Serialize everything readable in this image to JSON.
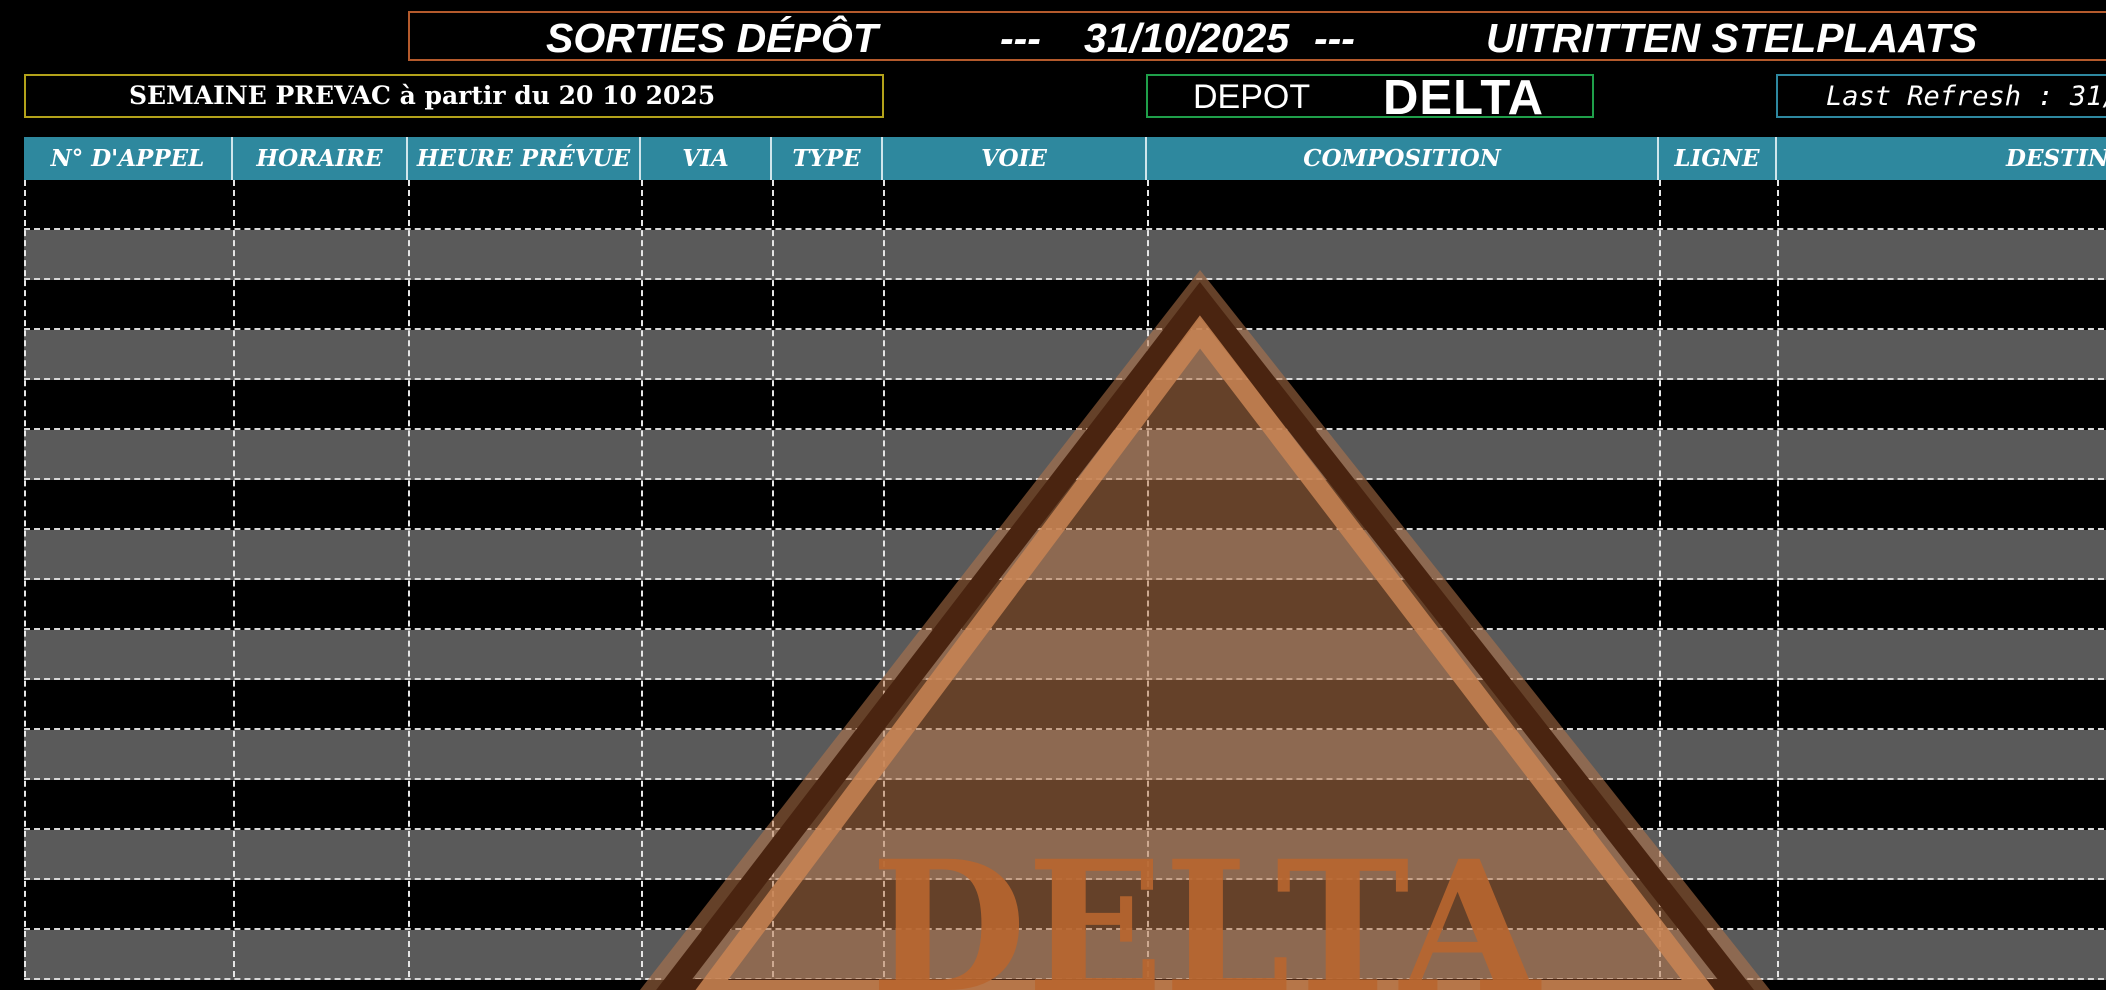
{
  "header": {
    "title_fr": "SORTIES DÉPÔT",
    "sep_left": "---",
    "date": "31/10/2025",
    "sep_right": "---",
    "title_nl": "UITRITTEN STELPLAATS"
  },
  "info": {
    "week": "SEMAINE PREVAC à partir du 20 10 2025",
    "depot_label": "DEPOT",
    "depot_value": "DELTA",
    "refresh": "Last Refresh : 31/"
  },
  "table": {
    "columns": [
      "N° D'APPEL",
      "HORAIRE",
      "HEURE PRÉVUE",
      "VIA",
      "TYPE",
      "VOIE",
      "COMPOSITION",
      "LIGNE",
      "DESTIN"
    ],
    "row_count": 16,
    "rows": []
  },
  "watermark": {
    "text": "DELTA"
  },
  "colors": {
    "background": "#000000",
    "header_bg": "#2e889e",
    "row_alt": "#5a5a5a",
    "title_border": "#b45a2c",
    "week_border": "#b3a21a",
    "depot_border": "#1f9f4a",
    "refresh_border": "#2e88a0",
    "watermark": "#b8774a"
  }
}
